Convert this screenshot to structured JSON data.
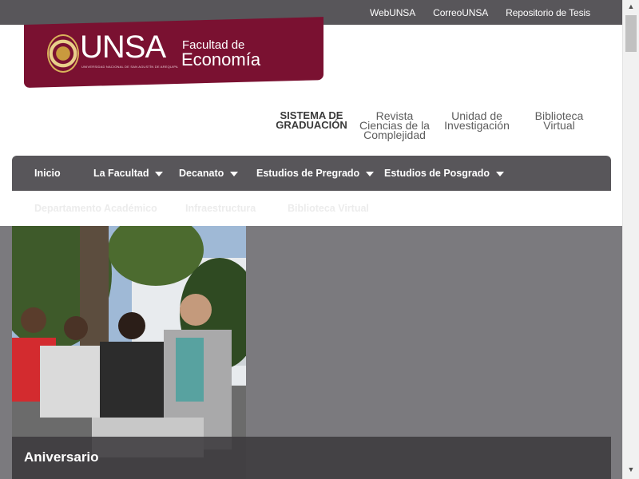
{
  "topbar": {
    "links": [
      "WebUNSA",
      "CorreoUNSA",
      "Repositorio de Tesis"
    ]
  },
  "logo": {
    "brand": "UNSA",
    "subtitle": "UNIVERSIDAD NACIONAL DE SAN AGUSTÍN DE AREQUIPA",
    "faculty_line1": "Facultad de",
    "faculty_line2": "Economía"
  },
  "secondary_nav": {
    "items": [
      {
        "line1": "SISTEMA DE",
        "line2": "GRADUACIÓN",
        "line3": ""
      },
      {
        "line1": "Revista",
        "line2": "Ciencias de la",
        "line3": "Complejidad"
      },
      {
        "line1": "Unidad de",
        "line2": "Investigación",
        "line3": ""
      },
      {
        "line1": "Biblioteca",
        "line2": "Virtual",
        "line3": ""
      }
    ]
  },
  "main_nav": {
    "items": [
      {
        "label": "Inicio"
      },
      {
        "label": "La Facultad"
      },
      {
        "label": "Decanato"
      },
      {
        "label": "Estudios de Pregrado"
      },
      {
        "label": "Estudios de Posgrado"
      }
    ],
    "sub_items": [
      "Departamento Académico",
      "Infraestructura",
      "Biblioteca Virtual"
    ]
  },
  "hero": {
    "caption": "Aniversario"
  },
  "colors": {
    "brand": "#7a1131",
    "nav": "#58565a",
    "hero_bg": "#7b7a7e"
  }
}
